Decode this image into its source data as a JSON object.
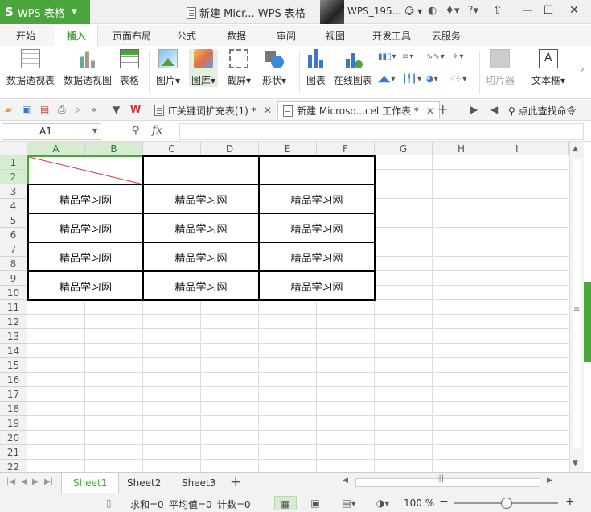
{
  "titlebar": {
    "app_label": "WPS 表格",
    "logo_text": "S",
    "document_title": "新建 Micr... WPS 表格",
    "username": "WPS_195...",
    "help_label": "?"
  },
  "menu": {
    "tabs": [
      "开始",
      "插入",
      "页面布局",
      "公式",
      "数据",
      "审阅",
      "视图",
      "开发工具",
      "云服务"
    ],
    "active": "插入"
  },
  "ribbon": {
    "pivot_table": "数据透视表",
    "pivot_chart": "数据透视图",
    "table": "表格",
    "picture": "图片",
    "gallery": "图库",
    "screenshot": "截屏",
    "shapes": "形状",
    "chart": "图表",
    "online_chart": "在线图表",
    "slicer": "切片器",
    "textbox": "文本框"
  },
  "doc_tabs": [
    {
      "label": "IT关键词扩充表(1) *",
      "active": false
    },
    {
      "label": "新建 Microso...cel 工作表 *",
      "active": true
    }
  ],
  "search_command": "点此查找命令",
  "formula_bar": {
    "cell_ref": "A1",
    "fx_label": "fx",
    "formula": ""
  },
  "grid": {
    "columns": [
      "A",
      "B",
      "C",
      "D",
      "E",
      "F",
      "G",
      "H",
      "I"
    ],
    "rows": [
      "1",
      "2",
      "3",
      "4",
      "5",
      "6",
      "7",
      "8",
      "9",
      "10",
      "11",
      "12",
      "13",
      "14",
      "15",
      "16",
      "17",
      "18",
      "19",
      "20",
      "21",
      "22"
    ],
    "selected_columns": [
      "A",
      "B"
    ],
    "selected_rows": [
      "1",
      "2"
    ],
    "table_cells": [
      [
        "精品学习网",
        "精品学习网",
        "精品学习网"
      ],
      [
        "精品学习网",
        "精品学习网",
        "精品学习网"
      ],
      [
        "精品学习网",
        "精品学习网",
        "精品学习网"
      ],
      [
        "精品学习网",
        "精品学习网",
        "精品学习网"
      ]
    ],
    "diagonal_color": "#e03030"
  },
  "sheets": {
    "tabs": [
      "Sheet1",
      "Sheet2",
      "Sheet3"
    ],
    "active": "Sheet1",
    "add_label": "+"
  },
  "status": {
    "sum": "求和=0",
    "average": "平均值=0",
    "count": "计数=0",
    "zoom": "100 %"
  },
  "colors": {
    "accent": "#4aa53b",
    "selection_fill": "#d7ead2"
  }
}
